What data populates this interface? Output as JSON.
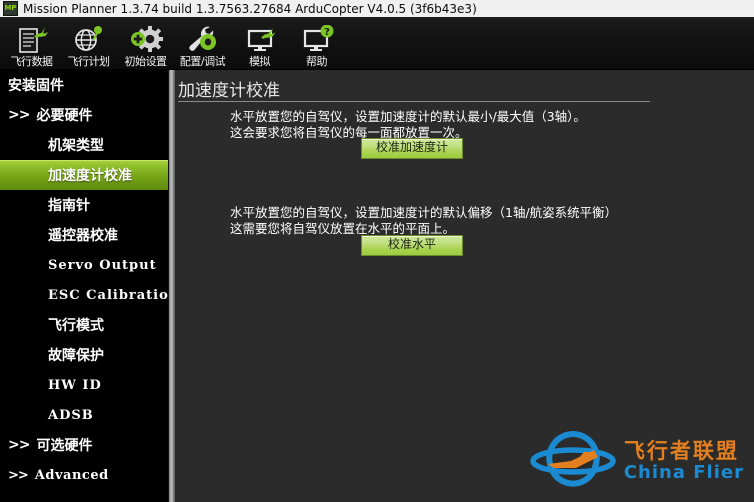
{
  "window": {
    "title": "Mission Planner 1.3.74 build 1.3.7563.27684 ArduCopter V4.0.5 (3f6b43e3)",
    "app_icon": "mission-planner-icon",
    "app_icon_label": "MP"
  },
  "toolbar": {
    "items": [
      {
        "label": "飞行数据",
        "icon": "flight-data-icon"
      },
      {
        "label": "飞行计划",
        "icon": "flight-plan-icon"
      },
      {
        "label": "初始设置",
        "icon": "initial-setup-icon"
      },
      {
        "label": "配置/调试",
        "icon": "config-tuning-icon"
      },
      {
        "label": "模拟",
        "icon": "simulation-icon"
      },
      {
        "label": "帮助",
        "icon": "help-icon"
      }
    ]
  },
  "sidebar": {
    "items": [
      {
        "label": "安装固件",
        "type": "head",
        "selected": false
      },
      {
        "label": "必要硬件",
        "type": "group",
        "chevron": ">>",
        "selected": false
      },
      {
        "label": "机架类型",
        "type": "child",
        "selected": false
      },
      {
        "label": "加速度计校准",
        "type": "child",
        "selected": true
      },
      {
        "label": "指南针",
        "type": "child",
        "selected": false
      },
      {
        "label": "遥控器校准",
        "type": "child",
        "selected": false
      },
      {
        "label": "Servo Output",
        "type": "child-latin",
        "selected": false
      },
      {
        "label": "ESC Calibration",
        "type": "child-latin",
        "selected": false
      },
      {
        "label": "飞行模式",
        "type": "child",
        "selected": false
      },
      {
        "label": "故障保护",
        "type": "child",
        "selected": false
      },
      {
        "label": "HW ID",
        "type": "child-latin",
        "selected": false
      },
      {
        "label": "ADSB",
        "type": "child-latin",
        "selected": false
      },
      {
        "label": "可选硬件",
        "type": "group",
        "chevron": ">>",
        "selected": false
      },
      {
        "label": "Advanced",
        "type": "group-latin",
        "chevron": ">>",
        "selected": false
      }
    ]
  },
  "main": {
    "page_title": "加速度计校准",
    "sections": [
      {
        "description": "水平放置您的自驾仪，设置加速度计的默认最小/最大值（3轴）。\n这会要求您将自驾仪的每一面都放置一次。",
        "button_label": "校准加速度计"
      },
      {
        "description": "水平放置您的自驾仪，设置加速度计的默认偏移（1轴/航姿系统平衡）\n这需要您将自驾仪放置在水平的平面上。",
        "button_label": "校准水平"
      }
    ]
  },
  "watermark": {
    "logo_icon": "china-flier-logo",
    "cn_text": "飞行者联盟",
    "en_text": "China Flier"
  },
  "colors": {
    "accent_green": "#8fc31f",
    "selected_green_top": "#a8d33c",
    "selected_green_bottom": "#5d8a0c",
    "panel_bg": "#2b2b2b",
    "sidebar_bg": "#000000",
    "titlebar_bg": "#f0f0f0",
    "watermark_orange": "#e8821e",
    "watermark_blue": "#1b8ed6"
  }
}
